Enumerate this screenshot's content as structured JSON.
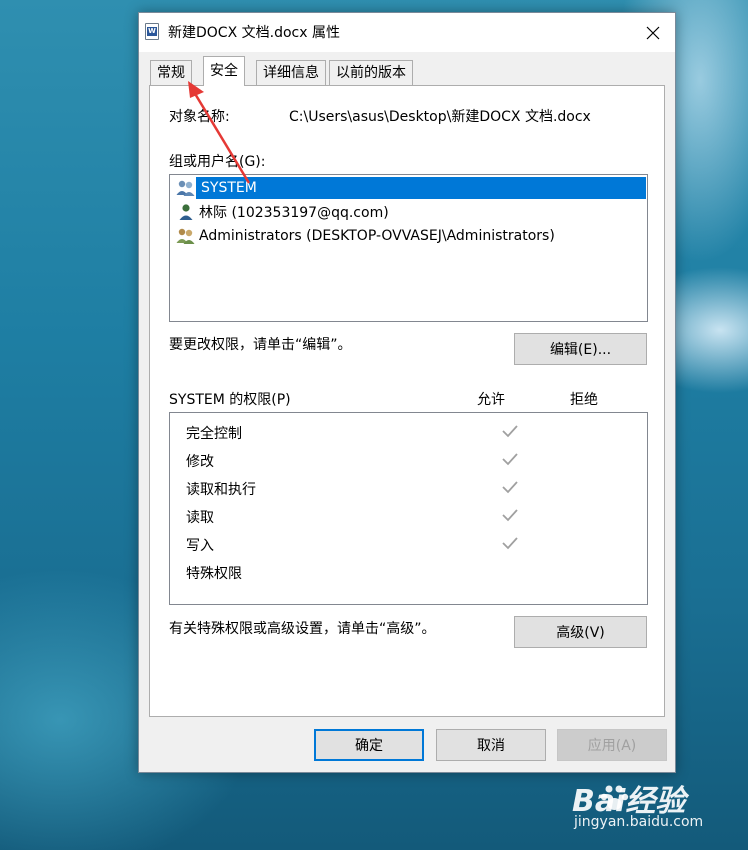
{
  "window": {
    "title": "新建DOCX 文档.docx 属性",
    "close_icon": "close-icon"
  },
  "tabs": [
    {
      "label": "常规",
      "active": false
    },
    {
      "label": "安全",
      "active": true
    },
    {
      "label": "详细信息",
      "active": false
    },
    {
      "label": "以前的版本",
      "active": false
    }
  ],
  "security": {
    "object_name_label": "对象名称:",
    "object_name_value": "C:\\Users\\asus\\Desktop\\新建DOCX 文档.docx",
    "groups_label": "组或用户名(G):",
    "users": [
      {
        "name": "SYSTEM",
        "icon": "group-users-icon",
        "selected": true
      },
      {
        "name": "林际 (102353197@qq.com)",
        "icon": "single-user-icon",
        "selected": false
      },
      {
        "name": "Administrators (DESKTOP-OVVASEJ\\Administrators)",
        "icon": "group-users-icon",
        "selected": false
      }
    ],
    "edit_hint": "要更改权限，请单击“编辑”。",
    "edit_button": "编辑(E)...",
    "permissions_label": "SYSTEM 的权限(P)",
    "allow_header": "允许",
    "deny_header": "拒绝",
    "permissions": [
      {
        "name": "完全控制",
        "allow": true,
        "deny": false
      },
      {
        "name": "修改",
        "allow": true,
        "deny": false
      },
      {
        "name": "读取和执行",
        "allow": true,
        "deny": false
      },
      {
        "name": "读取",
        "allow": true,
        "deny": false
      },
      {
        "name": "写入",
        "allow": true,
        "deny": false
      },
      {
        "name": "特殊权限",
        "allow": false,
        "deny": false
      }
    ],
    "advanced_hint": "有关特殊权限或高级设置，请单击“高级”。",
    "advanced_button": "高级(V)"
  },
  "footer": {
    "ok": "确定",
    "cancel": "取消",
    "apply": "应用(A)"
  },
  "watermark": {
    "brand": "Bai经验",
    "url": "jingyan.baidu.com"
  },
  "colors": {
    "selection": "#0078d7",
    "annotation_arrow": "#e53935",
    "check": "#a0a0a0"
  }
}
